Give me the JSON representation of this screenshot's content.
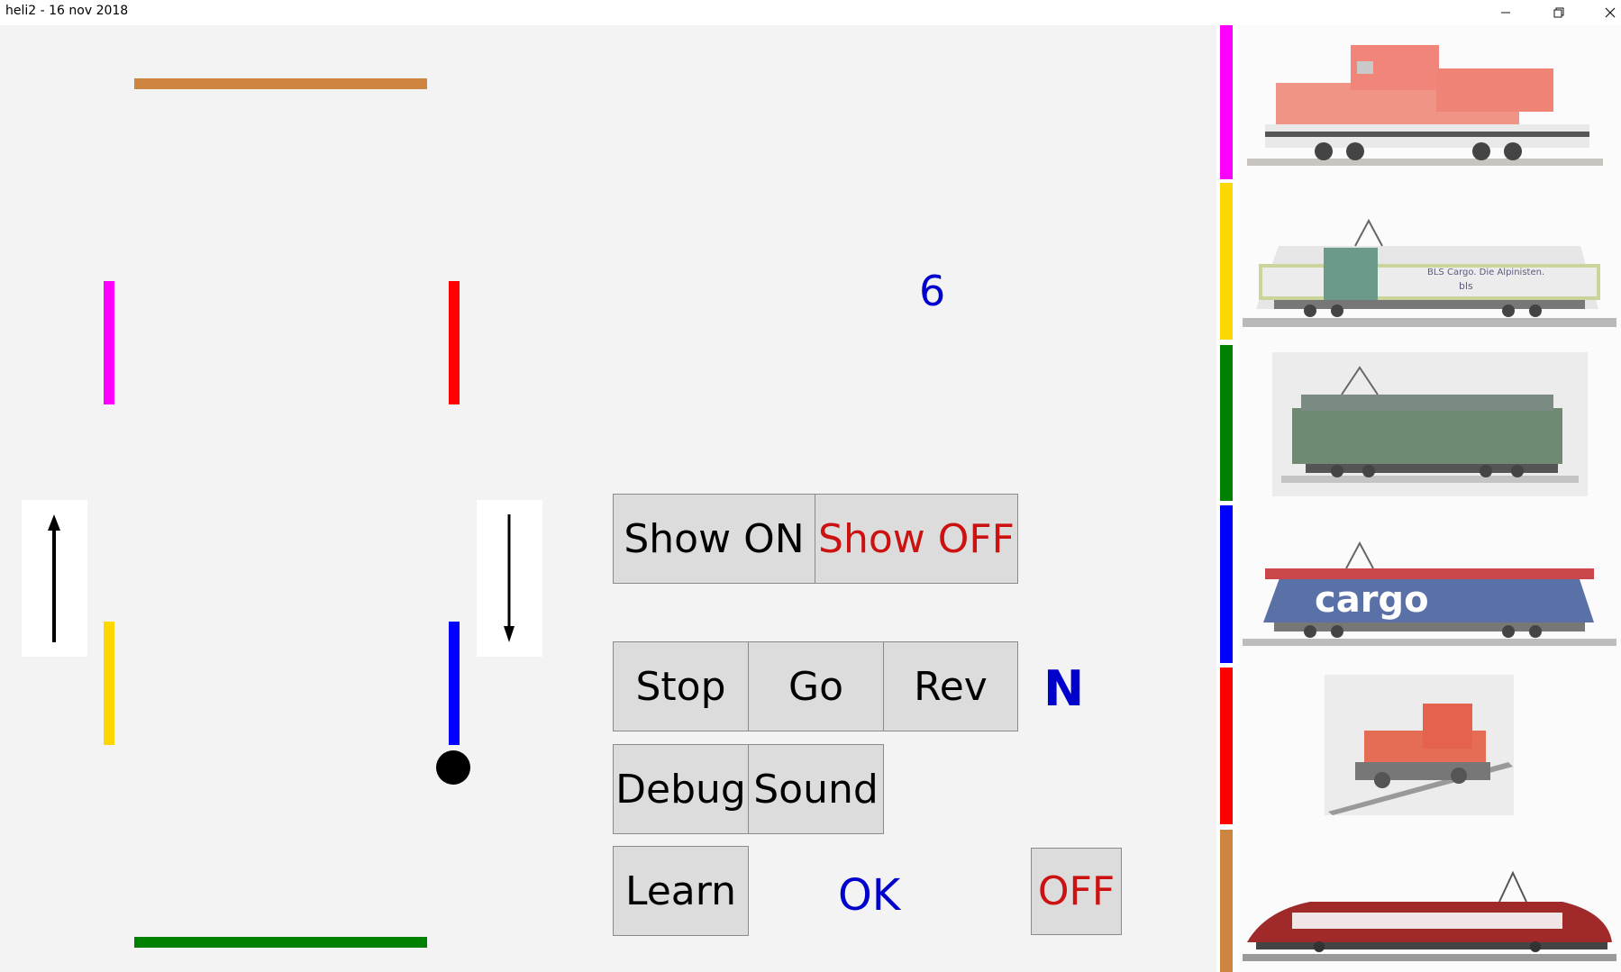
{
  "window": {
    "title": "heli2 - 16 nov 2018",
    "minimize_icon": "minimize-icon",
    "restore_icon": "restore-icon",
    "close_icon": "close-icon"
  },
  "layout": {
    "tracks": [
      {
        "name": "track-top-brown",
        "color": "#cd853f"
      },
      {
        "name": "track-left-magenta",
        "color": "#ff00ff"
      },
      {
        "name": "track-right-red",
        "color": "#ff0000"
      },
      {
        "name": "track-left-yellow",
        "color": "#ffd700"
      },
      {
        "name": "track-right-blue",
        "color": "#0000ff"
      },
      {
        "name": "track-bottom-green",
        "color": "#008000"
      }
    ],
    "counter": "6",
    "direction_up_icon": "arrow-up-icon",
    "direction_down_icon": "arrow-down-icon",
    "train_marker_icon": "train-position-dot-icon"
  },
  "controls": {
    "show_on": "Show ON",
    "show_off": "Show OFF",
    "stop": "Stop",
    "go": "Go",
    "rev": "Rev",
    "mode_indicator": "N",
    "debug": "Debug",
    "sound": "Sound",
    "learn": "Learn",
    "status": "OK",
    "off": "OFF",
    "colors": {
      "show_off_text": "#cc1111",
      "blue_text": "#0000cc",
      "off_text": "#cc1111"
    }
  },
  "locomotives": [
    {
      "name": "loco-red-diesel",
      "color": "#ff00ff",
      "image": "red-diesel-locomotive-image"
    },
    {
      "name": "loco-bls-cargo",
      "color": "#ffd700",
      "image": "bls-cargo-locomotive-image",
      "caption": "BLS Cargo. Die Alpinisten.",
      "brand": "bls"
    },
    {
      "name": "loco-green-re44",
      "color": "#008000",
      "image": "green-electric-locomotive-image"
    },
    {
      "name": "loco-sbb-cargo",
      "color": "#0000ff",
      "image": "cargo-electric-locomotive-image",
      "caption": "cargo"
    },
    {
      "name": "loco-red-shunter",
      "color": "#ff0000",
      "image": "red-shunter-locomotive-image"
    },
    {
      "name": "loco-red-arrow",
      "color": "#cd853f",
      "image": "red-arrow-railcar-image"
    }
  ]
}
